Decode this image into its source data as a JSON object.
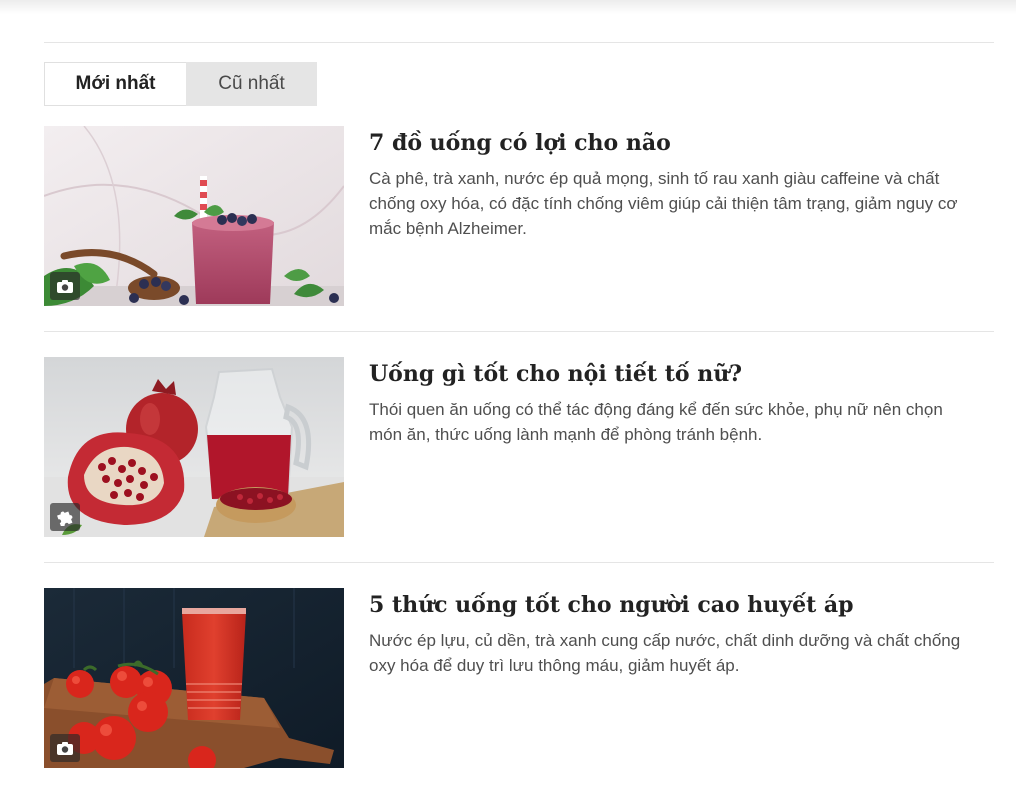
{
  "tabs": {
    "newest_label": "Mới nhất",
    "oldest_label": "Cũ nhất"
  },
  "articles": [
    {
      "title": "7 đồ uống có lợi cho não",
      "description": "Cà phê, trà xanh, nước ép quả mọng, sinh tố rau xanh giàu caffeine và chất chống oxy hóa, có đặc tính chống viêm giúp cải thiện tâm trạng, giảm nguy cơ mắc bệnh Alzheimer.",
      "media_icon": "camera-icon"
    },
    {
      "title": "Uống gì tốt cho nội tiết tố nữ?",
      "description": "Thói quen ăn uống có thể tác động đáng kể đến sức khỏe, phụ nữ nên chọn món ăn, thức uống lành mạnh để phòng tránh bệnh.",
      "media_icon": "puzzle-icon"
    },
    {
      "title": "5 thức uống tốt cho người cao huyết áp",
      "description": "Nước ép lựu, củ dền, trà xanh cung cấp nước, chất dinh dưỡng và chất chống oxy hóa để duy trì lưu thông máu, giảm huyết áp.",
      "media_icon": "camera-icon"
    }
  ]
}
